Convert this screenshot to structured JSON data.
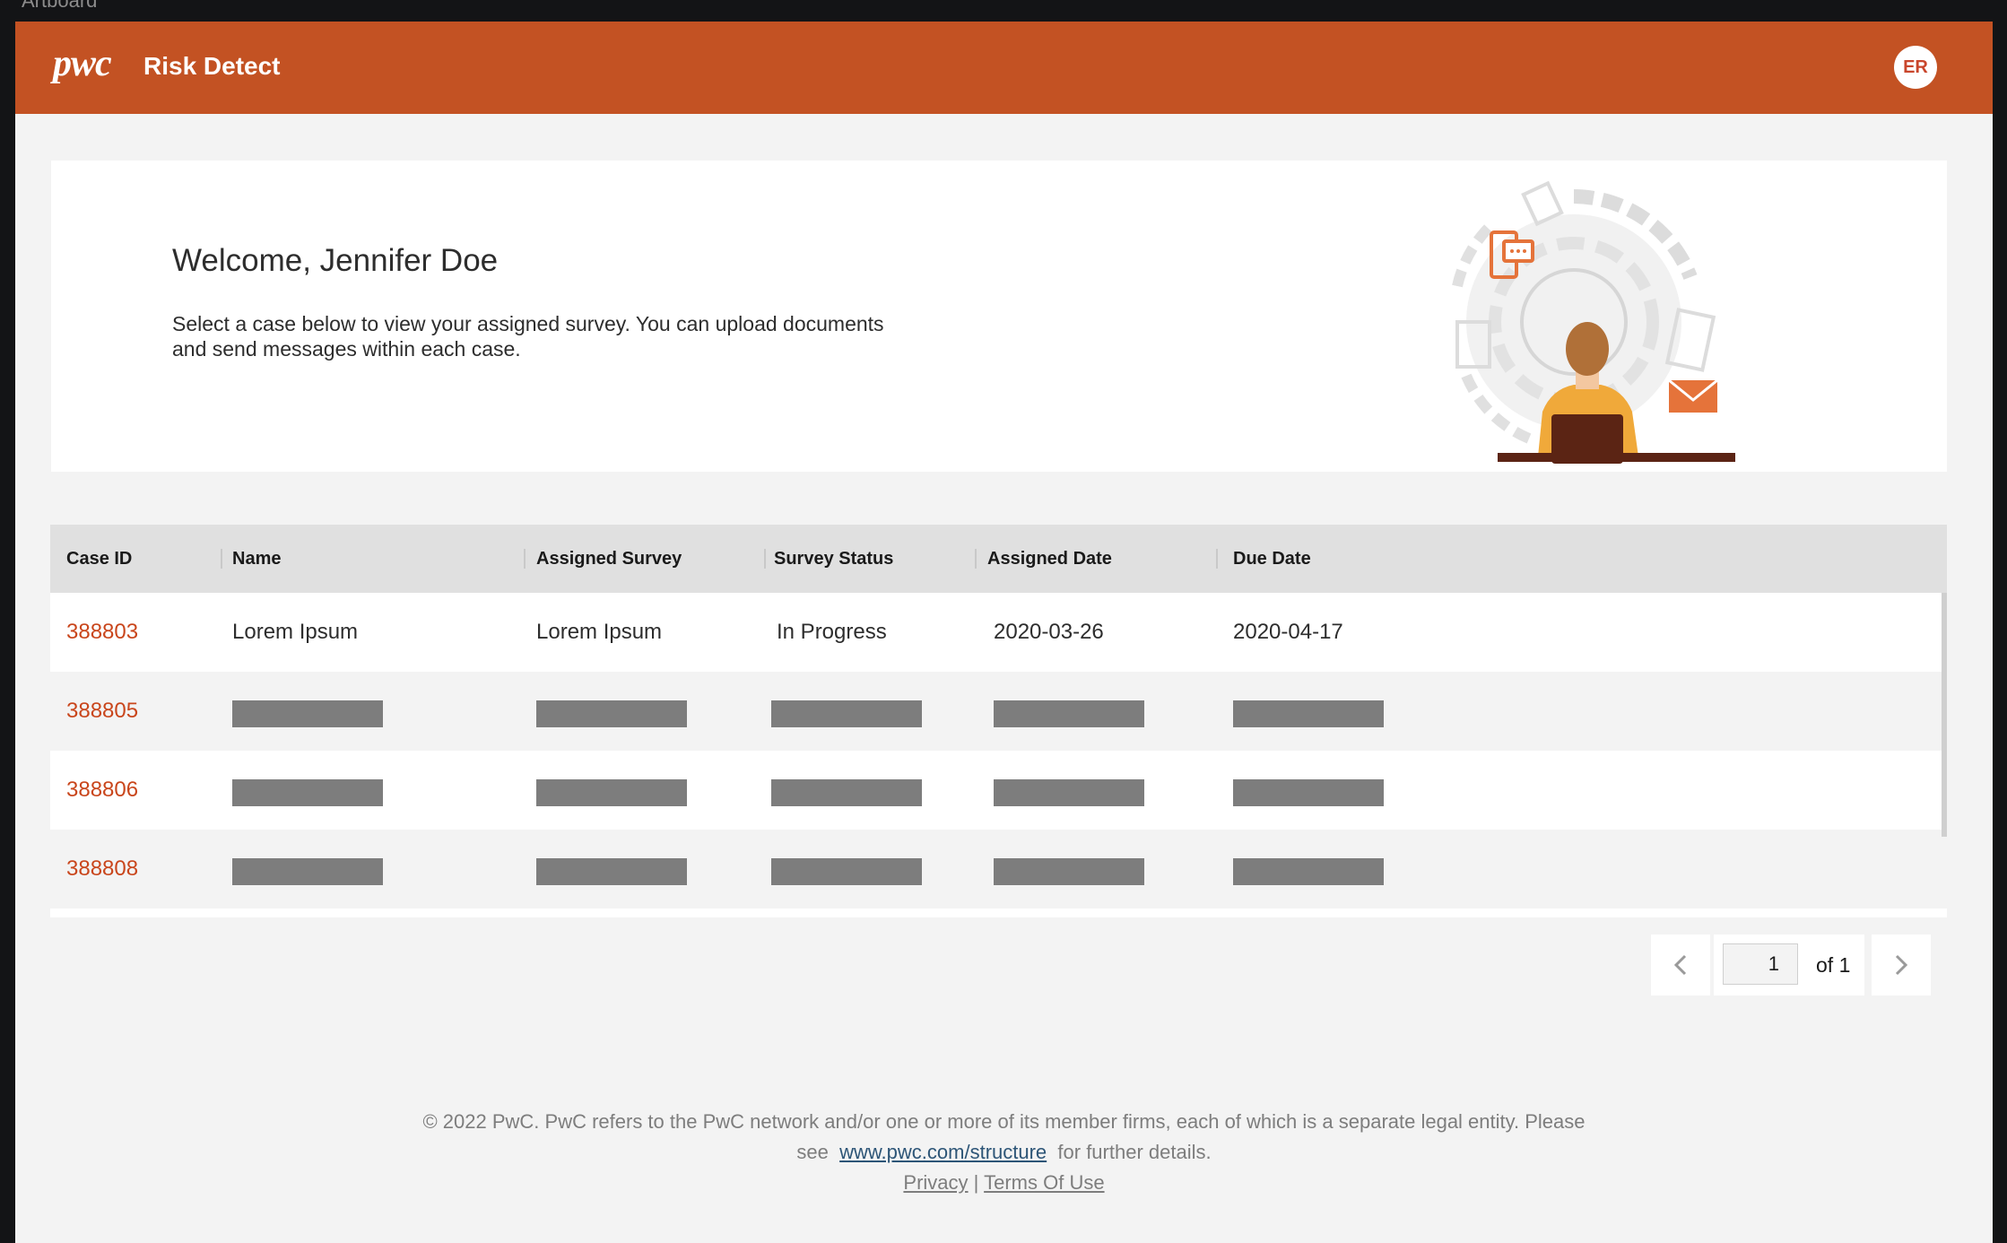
{
  "artboard_label": "Artboard",
  "header": {
    "logo": "pwc",
    "app_title": "Risk Detect",
    "avatar_initials": "ER",
    "brand_color": "#c35223"
  },
  "welcome": {
    "title": "Welcome, Jennifer Doe",
    "line1": "Select a case below to view your assigned survey. You can upload documents",
    "line2": "and send messages within each case."
  },
  "table": {
    "columns": [
      "Case ID",
      "Name",
      "Assigned Survey",
      "Survey Status",
      "Assigned Date",
      "Due Date"
    ],
    "rows": [
      {
        "case_id": "388803",
        "name": "Lorem Ipsum",
        "survey": "Lorem Ipsum",
        "status": "In Progress",
        "assigned": "2020-03-26",
        "due": "2020-04-17"
      },
      {
        "case_id": "388805",
        "redacted": true
      },
      {
        "case_id": "388806",
        "redacted": true
      },
      {
        "case_id": "388808",
        "redacted": true
      }
    ]
  },
  "pagination": {
    "current_page": "1",
    "of_label": "of 1",
    "prev_icon": "chevron-left-icon",
    "next_icon": "chevron-right-icon"
  },
  "footer": {
    "line1": "© 2022 PwC. PwC refers to the PwC network and/or one or more of its member firms, each of which is a separate legal entity. Please",
    "see": "see",
    "link": "www.pwc.com/structure",
    "after_link": "for further details.",
    "privacy": "Privacy",
    "divider": "|",
    "terms": "Terms Of Use"
  }
}
